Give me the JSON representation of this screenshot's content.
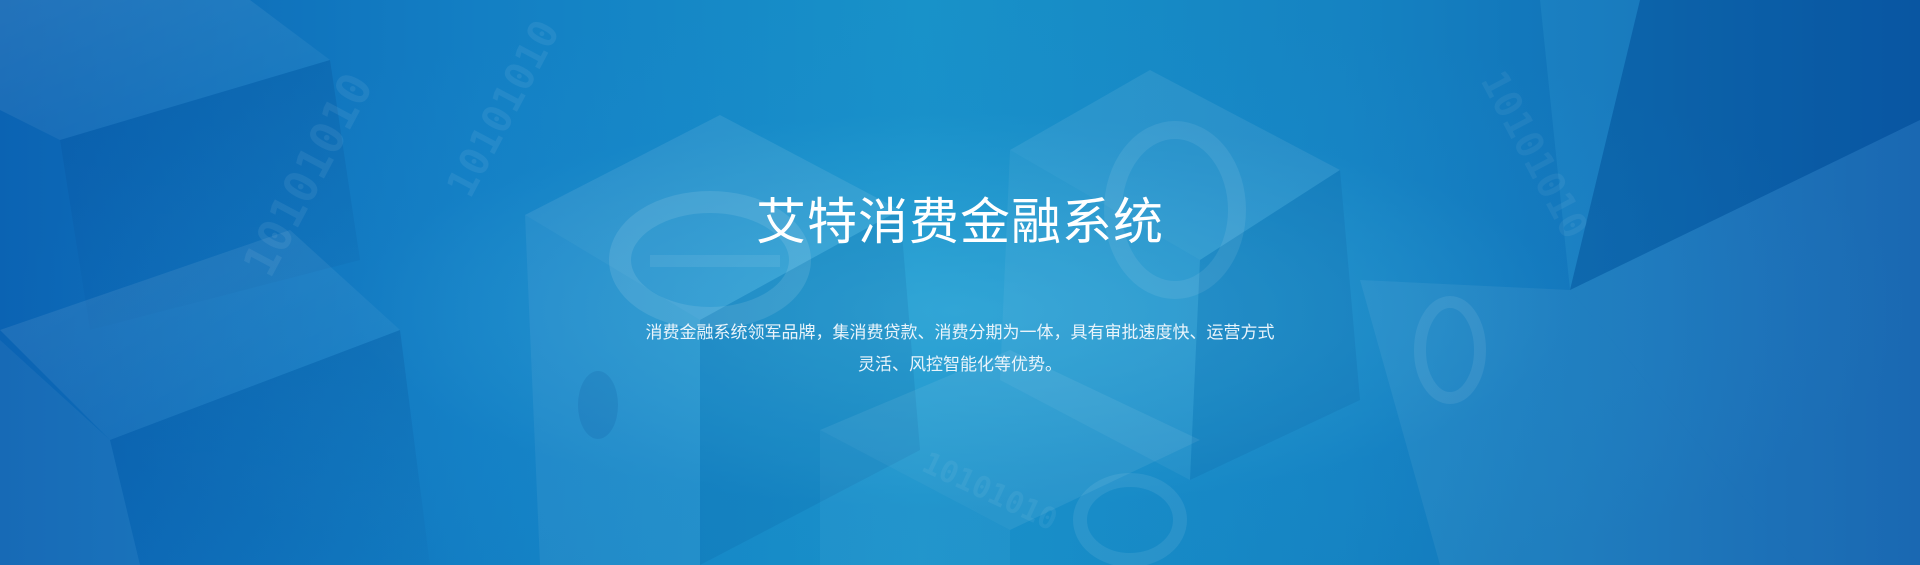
{
  "banner": {
    "title": "艾特消费金融系统",
    "description_line1": "消费金融系统领军品牌，集消费贷款、消费分期为一体，具有审批速度快、运营方式",
    "description_line2": "灵活、风控智能化等优势。",
    "background_colors": {
      "left": "#0b63b3",
      "center": "#1892c9",
      "right": "#0c5fae"
    },
    "decorative_text": "10101010"
  }
}
